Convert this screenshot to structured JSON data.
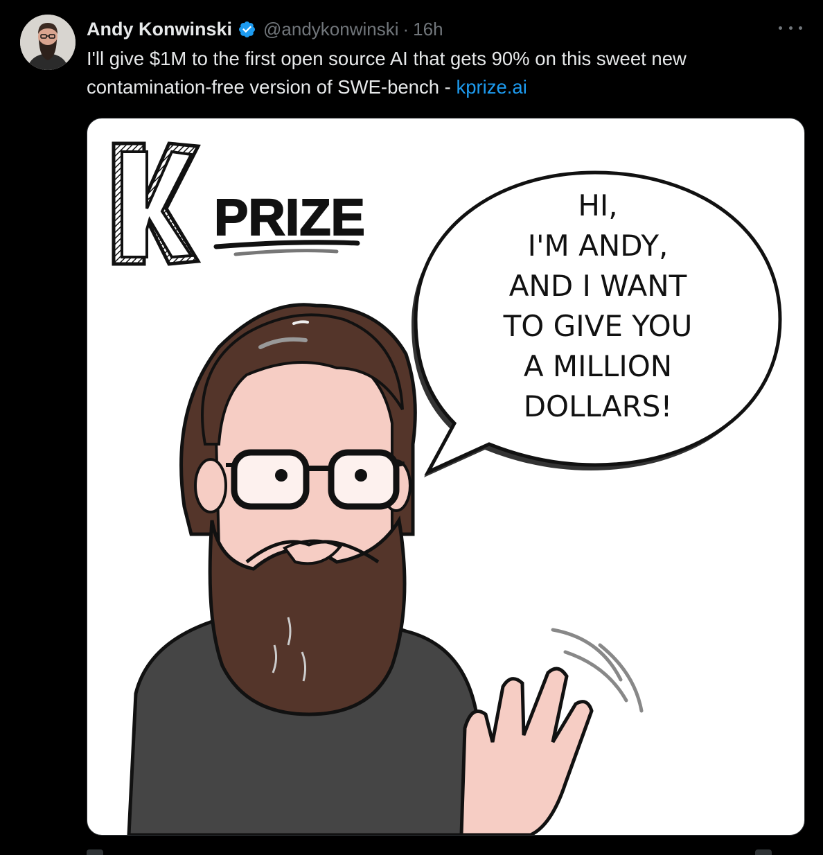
{
  "tweet": {
    "author_name": "Andy Konwinski",
    "verified": true,
    "handle": "@andykonwinski",
    "separator": "·",
    "time": "16h",
    "text_before_link": "I'll give $1M to the first open source AI that gets 90% on this sweet new contamination-free version of SWE-bench - ",
    "link_text": "kprize.ai"
  },
  "media": {
    "logo_letter": "K",
    "logo_word": "PRIZE",
    "speech_lines": [
      "HI,",
      "I'M ANDY,",
      "AND I WANT",
      "TO GIVE YOU",
      "A MILLION",
      "DOLLARS!"
    ]
  },
  "colors": {
    "background": "#000000",
    "text": "#e7e9ea",
    "muted": "#71767b",
    "link": "#1d9bf0",
    "verified": "#1d9bf0",
    "hair": "#54352a",
    "skin": "#f6cdc4",
    "shirt": "#454545"
  },
  "icons": {
    "verified": "verified-badge-icon",
    "more": "more-options-icon"
  }
}
